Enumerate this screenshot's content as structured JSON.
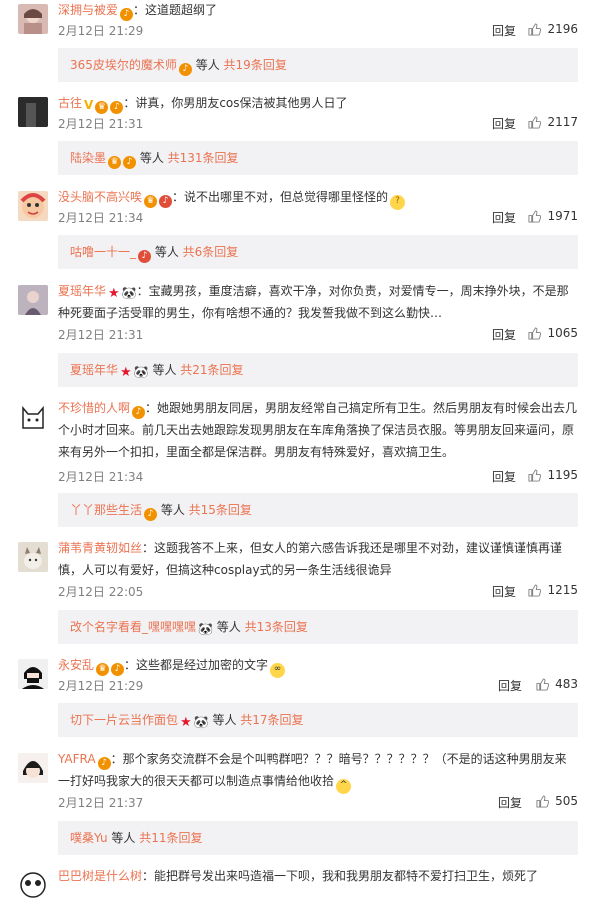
{
  "comments": [
    {
      "user": "深拥与被爱",
      "text": "：这道题超纲了",
      "time": "2月12日 21:29",
      "reply": "回复",
      "likes": "2196",
      "sub_user": "365皮埃尔的魔术师",
      "sub_mid": " 等人 ",
      "sub_count": "共19条回复"
    },
    {
      "user": "古往",
      "text": "：讲真，你男朋友cos保洁被其他男人日了",
      "time": "2月12日 21:31",
      "reply": "回复",
      "likes": "2117",
      "sub_user": "陆染墨",
      "sub_mid": " 等人 ",
      "sub_count": "共131条回复"
    },
    {
      "user": "没头脑不高兴唉",
      "text": "：说不出哪里不对，但总觉得哪里怪怪的",
      "time": "2月12日 21:34",
      "reply": "回复",
      "likes": "1971",
      "sub_user": "咕噜一十一_",
      "sub_mid": " 等人 ",
      "sub_count": "共6条回复"
    },
    {
      "user": "夏瑶年华",
      "text": "：宝藏男孩，重度洁癖，喜欢干净，对你负责，对爱情专一，周末挣外块，不是那种死要面子活受罪的男生，你有啥想不通的？我发誓我做不到这么勤快…",
      "time": "2月12日 21:31",
      "reply": "回复",
      "likes": "1065",
      "sub_user": "夏瑶年华",
      "sub_mid": " 等人 ",
      "sub_count": "共21条回复"
    },
    {
      "user": "不珍惜的人啊",
      "text": "：她跟她男朋友同居，男朋友经常自己搞定所有卫生。然后男朋友有时候会出去几个小时才回来。前几天出去她跟踪发现男朋友在车库角落换了保洁员衣服。等男朋友回来逼问，原来有另外一个扣扣，里面全都是保洁群。男朋友有特殊爱好，喜欢搞卫生。",
      "time": "2月12日 21:34",
      "reply": "回复",
      "likes": "1195",
      "sub_user": "丫丫那些生活",
      "sub_mid": " 等人 ",
      "sub_count": "共15条回复"
    },
    {
      "user": "蒲苇青黄轫如丝",
      "text": "：这题我答不上来，但女人的第六感告诉我还是哪里不对劲，建议谨慎谨慎再谨慎，人可以有爱好，但搞这种cosplay式的另一条生活线很诡异",
      "time": "2月12日 22:05",
      "reply": "回复",
      "likes": "1215",
      "sub_user": "改个名字看看_嘿嘿嘿嘿",
      "sub_mid": " 等人 ",
      "sub_count": "共13条回复"
    },
    {
      "user": "永安乱",
      "text": "：这些都是经过加密的文字",
      "time": "2月12日 21:29",
      "reply": "回复",
      "likes": "483",
      "sub_user": "切下一片云当作面包",
      "sub_mid": " 等人 ",
      "sub_count": "共17条回复"
    },
    {
      "user": "YAFRA",
      "text": "：那个家务交流群不会是个叫鸭群吧？？？暗号？？？？？？（不是的话这种男朋友来一打好吗我家大的很天天都可以制造点事情给他收拾",
      "time": "2月12日 21:37",
      "reply": "回复",
      "likes": "505",
      "sub_user": "噗桑Yu",
      "sub_mid": " 等人 ",
      "sub_count": "共11条回复"
    },
    {
      "user": "巴巴树是什么树",
      "text": "：能把群号发出来吗造福一下呗，我和我男朋友都特不爱打扫卫生，烦死了"
    }
  ]
}
